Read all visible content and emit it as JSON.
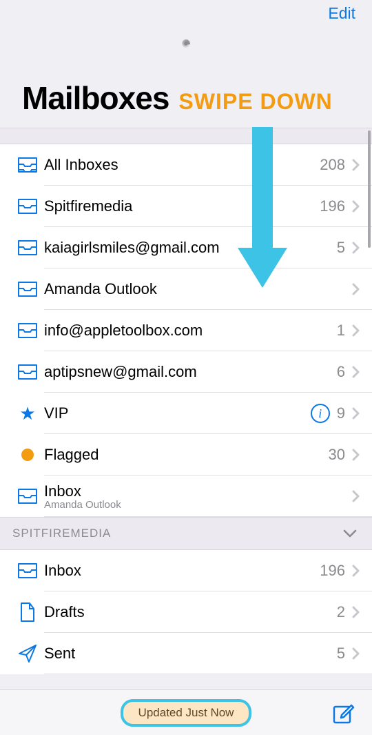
{
  "nav": {
    "edit": "Edit"
  },
  "title": "Mailboxes",
  "annotation": "SWIPE DOWN",
  "mailboxes": [
    {
      "icon": "tray-all",
      "label": "All Inboxes",
      "count": "208"
    },
    {
      "icon": "tray",
      "label": "Spitfiremedia",
      "count": "196"
    },
    {
      "icon": "tray",
      "label": "kaiagirlsmiles@gmail.com",
      "count": "5"
    },
    {
      "icon": "tray",
      "label": "Amanda Outlook",
      "count": ""
    },
    {
      "icon": "tray",
      "label": "info@appletoolbox.com",
      "count": "1"
    },
    {
      "icon": "tray",
      "label": "aptipsnew@gmail.com",
      "count": "6"
    },
    {
      "icon": "star",
      "label": "VIP",
      "count": "9",
      "info": true
    },
    {
      "icon": "dot",
      "label": "Flagged",
      "count": "30"
    },
    {
      "icon": "tray",
      "label": "Inbox",
      "sublabel": "Amanda Outlook",
      "count": ""
    }
  ],
  "section": {
    "title": "SPITFIREMEDIA",
    "items": [
      {
        "icon": "tray",
        "label": "Inbox",
        "count": "196"
      },
      {
        "icon": "doc",
        "label": "Drafts",
        "count": "2"
      },
      {
        "icon": "send",
        "label": "Sent",
        "count": "5"
      }
    ]
  },
  "toolbar": {
    "status": "Updated Just Now"
  }
}
